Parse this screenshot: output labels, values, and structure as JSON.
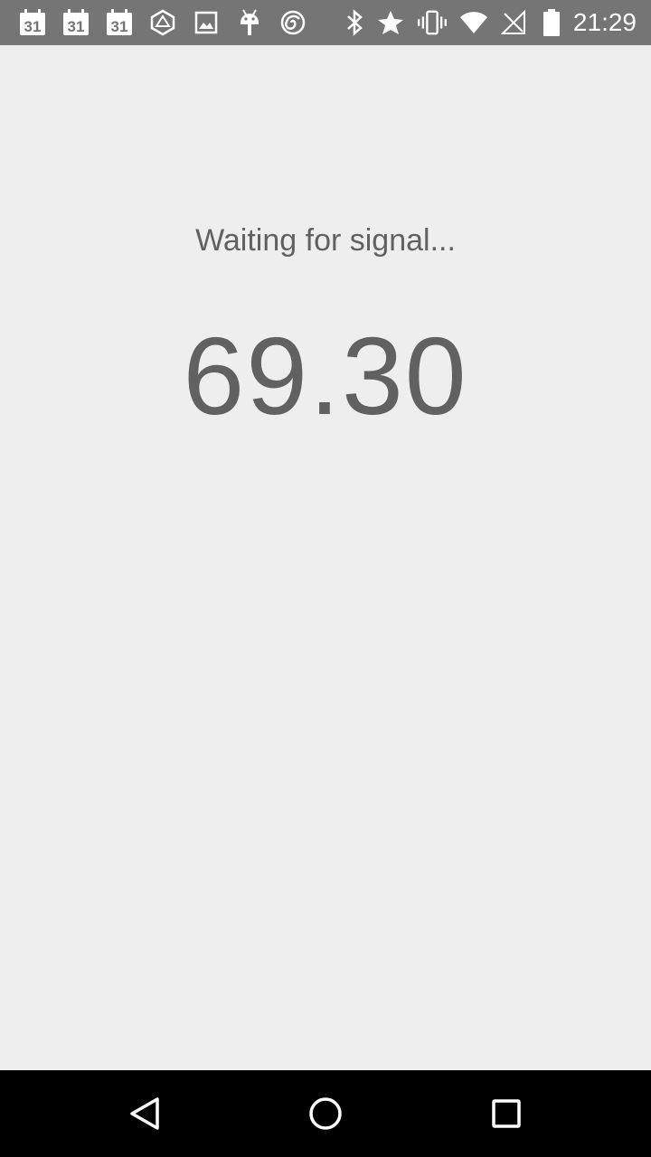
{
  "status_bar": {
    "time": "21:29",
    "notification_icons": [
      {
        "name": "calendar-icon",
        "label": "31"
      },
      {
        "name": "calendar-icon",
        "label": "31"
      },
      {
        "name": "calendar-icon",
        "label": "31"
      },
      {
        "name": "ingress-icon"
      },
      {
        "name": "image-icon"
      },
      {
        "name": "android-debug-icon"
      },
      {
        "name": "spiral-icon"
      }
    ],
    "system_icons": [
      "bluetooth-icon",
      "star-icon",
      "vibrate-icon",
      "wifi-icon",
      "no-signal-icon",
      "battery-icon"
    ]
  },
  "main": {
    "status_text": "Waiting for signal...",
    "reading_value": "69.30"
  },
  "nav_bar": {
    "buttons": [
      "back-icon",
      "home-icon",
      "recents-icon"
    ]
  },
  "colors": {
    "status_bar_bg": "#757575",
    "background": "#eeeeee",
    "text": "#616161",
    "nav_bar_bg": "#000000"
  }
}
